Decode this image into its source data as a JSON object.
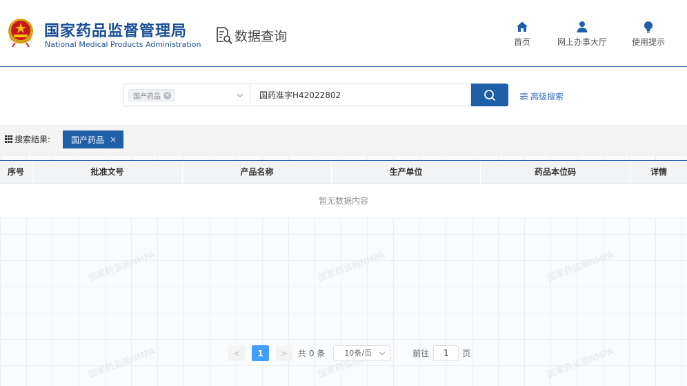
{
  "header": {
    "org_name_cn": "国家药品监督管理局",
    "org_name_en": "National Medical Products Administration",
    "page_title": "数据查询",
    "nav": [
      {
        "label": "首页",
        "icon": "home-icon"
      },
      {
        "label": "网上办事大厅",
        "icon": "user-icon"
      },
      {
        "label": "使用提示",
        "icon": "lightbulb-icon"
      }
    ]
  },
  "search": {
    "category_tag": "国产药品",
    "query_value": "国药准字H42022802",
    "advanced_label": "高级搜索"
  },
  "results": {
    "label": "搜索结果:",
    "active_filter": "国产药品",
    "close_glyph": "×"
  },
  "table": {
    "columns": [
      "序号",
      "批准文号",
      "产品名称",
      "生产单位",
      "药品本位码",
      "详情"
    ],
    "empty_text": "暂无数据内容"
  },
  "watermark": {
    "text": "国家药监局NMPA"
  },
  "pagination": {
    "prev": "<",
    "current_page": "1",
    "next": ">",
    "total_text": "共 0 条",
    "page_size": "10条/页",
    "goto_label": "前往",
    "goto_value": "1",
    "page_suffix": "页"
  },
  "colors": {
    "brand_blue": "#1f5fa8",
    "pager_active": "#409eff",
    "link_blue": "#2f6fc0"
  }
}
